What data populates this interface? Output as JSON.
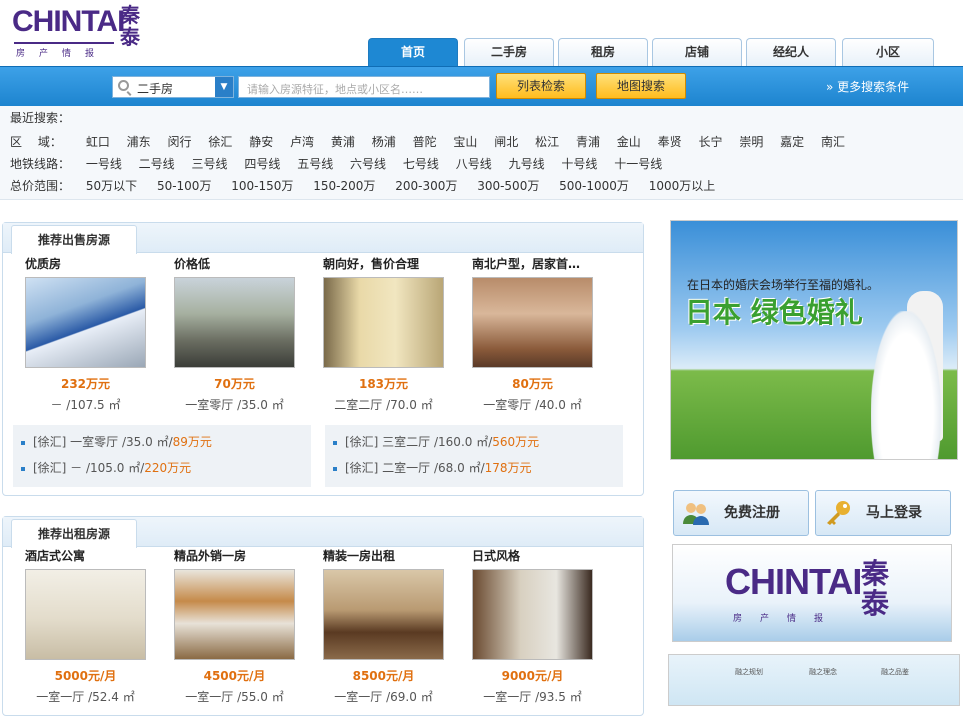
{
  "logo": {
    "en": "CHINTAI",
    "cn": "秦泰",
    "sub": "房产情报"
  },
  "tabs": [
    "首页",
    "二手房",
    "租房",
    "店铺",
    "经纪人",
    "小区"
  ],
  "active_tab": 0,
  "search": {
    "type_value": "二手房",
    "placeholder": "请输入房源特征，地点或小区名……",
    "list_button": "列表检索",
    "map_button": "地图搜索",
    "more": "» 更多搜索条件"
  },
  "filters": {
    "recent_label": "最近搜索：",
    "district_label": "区　 域：",
    "districts": [
      "虹口",
      "浦东",
      "闵行",
      "徐汇",
      "静安",
      "卢湾",
      "黄浦",
      "杨浦",
      "普陀",
      "宝山",
      "闸北",
      "松江",
      "青浦",
      "金山",
      "奉贤",
      "长宁",
      "崇明",
      "嘉定",
      "南汇"
    ],
    "metro_label": "地铁线路：",
    "metro": [
      "一号线",
      "二号线",
      "三号线",
      "四号线",
      "五号线",
      "六号线",
      "七号线",
      "八号线",
      "九号线",
      "十号线",
      "十一号线"
    ],
    "price_label": "总价范围：",
    "prices": [
      "50万以下",
      "50-100万",
      "100-150万",
      "150-200万",
      "200-300万",
      "300-500万",
      "500-1000万",
      "1000万以上"
    ]
  },
  "sale": {
    "title": "推荐出售房源",
    "cards": [
      {
        "name": "优质房",
        "price": "232万元",
        "size": "－ /107.5 ㎡"
      },
      {
        "name": "价格低",
        "price": "70万元",
        "size": "一室零厅 /35.0 ㎡"
      },
      {
        "name": "朝向好，售价合理",
        "price": "183万元",
        "size": "二室二厅 /70.0 ㎡"
      },
      {
        "name": "南北户型，居家首…",
        "price": "80万元",
        "size": "一室零厅 /40.0 ㎡"
      }
    ],
    "list_left": [
      {
        "desc": "[徐汇] 一室零厅 /35.0 ㎡/",
        "price": "89万元"
      },
      {
        "desc": "[徐汇] － /105.0 ㎡/",
        "price": "220万元"
      }
    ],
    "list_right": [
      {
        "desc": "[徐汇] 三室二厅 /160.0 ㎡/",
        "price": "560万元"
      },
      {
        "desc": "[徐汇] 二室一厅 /68.0 ㎡/",
        "price": "178万元"
      }
    ]
  },
  "rent": {
    "title": "推荐出租房源",
    "cards": [
      {
        "name": "酒店式公寓",
        "price": "5000元/月",
        "size": "一室一厅 /52.4 ㎡"
      },
      {
        "name": "精品外销一房",
        "price": "4500元/月",
        "size": "一室一厅 /55.0 ㎡"
      },
      {
        "name": "精装一房出租",
        "price": "8500元/月",
        "size": "一室一厅 /69.0 ㎡"
      },
      {
        "name": "日式风格",
        "price": "9000元/月",
        "size": "一室一厅 /93.5 ㎡"
      }
    ]
  },
  "side": {
    "ad1_line1": "在日本的婚庆会场举行至福的婚礼。",
    "ad1_line2": "日本 绿色婚礼",
    "register": "免费注册",
    "login": "马上登录",
    "ad2_en": "CHINTAI",
    "ad2_cn": "秦泰",
    "ad2_sub": "房产情报",
    "ad3_labels": [
      "融之规划",
      "融之理念",
      "融之品鉴"
    ]
  },
  "colors": {
    "brand": "#4a2a86",
    "bar": "#1d84cf",
    "price": "#e07010"
  }
}
